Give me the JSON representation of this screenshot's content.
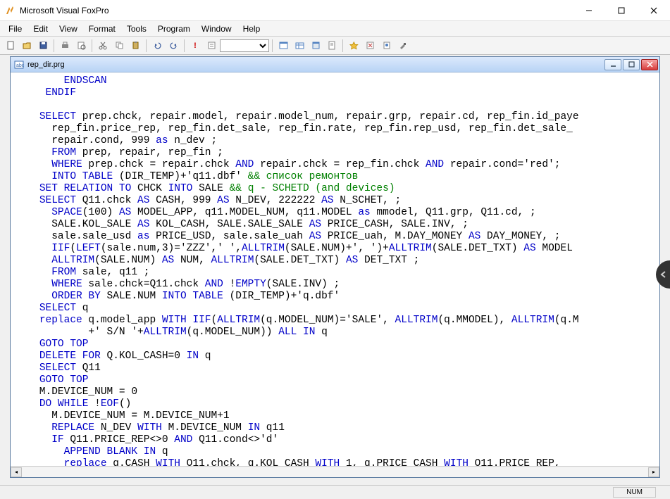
{
  "app": {
    "title": "Microsoft Visual FoxPro"
  },
  "menu": {
    "file": "File",
    "edit": "Edit",
    "view": "View",
    "format": "Format",
    "tools": "Tools",
    "program": "Program",
    "window": "Window",
    "help": "Help"
  },
  "toolbar": {
    "combo_value": ""
  },
  "doc": {
    "filename": "rep_dir.prg"
  },
  "code_lines": [
    {
      "indent": 8,
      "segs": [
        {
          "t": "ENDSCAN",
          "c": "kw"
        }
      ]
    },
    {
      "indent": 5,
      "segs": [
        {
          "t": "ENDIF",
          "c": "kw"
        }
      ]
    },
    {
      "indent": 0,
      "segs": [
        {
          "t": "",
          "c": ""
        }
      ]
    },
    {
      "indent": 4,
      "segs": [
        {
          "t": "SELECT",
          "c": "kw"
        },
        {
          "t": " prep.chck, repair.model, repair.model_num, repair.grp, repair.cd, rep_fin.id_paye",
          "c": ""
        }
      ]
    },
    {
      "indent": 6,
      "segs": [
        {
          "t": "rep_fin.price_rep, rep_fin.det_sale, rep_fin.rate, rep_fin.rep_usd, rep_fin.det_sale_",
          "c": ""
        }
      ]
    },
    {
      "indent": 6,
      "segs": [
        {
          "t": "repair.cond, 999 ",
          "c": ""
        },
        {
          "t": "as",
          "c": "kw"
        },
        {
          "t": " n_dev ;",
          "c": ""
        }
      ]
    },
    {
      "indent": 6,
      "segs": [
        {
          "t": "FROM",
          "c": "kw"
        },
        {
          "t": " prep, repair, rep_fin ;",
          "c": ""
        }
      ]
    },
    {
      "indent": 6,
      "segs": [
        {
          "t": "WHERE",
          "c": "kw"
        },
        {
          "t": " prep.chck = repair.chck ",
          "c": ""
        },
        {
          "t": "AND",
          "c": "kw"
        },
        {
          "t": " repair.chck = rep_fin.chck ",
          "c": ""
        },
        {
          "t": "AND",
          "c": "kw"
        },
        {
          "t": " repair.cond='red';",
          "c": ""
        }
      ]
    },
    {
      "indent": 6,
      "segs": [
        {
          "t": "INTO TABLE",
          "c": "kw"
        },
        {
          "t": " (DIR_TEMP)+'q11.dbf' ",
          "c": ""
        },
        {
          "t": "&& список ремонтов",
          "c": "cm"
        }
      ]
    },
    {
      "indent": 4,
      "segs": [
        {
          "t": "SET RELATION TO",
          "c": "kw"
        },
        {
          "t": " CHCK ",
          "c": ""
        },
        {
          "t": "INTO",
          "c": "kw"
        },
        {
          "t": " SALE ",
          "c": ""
        },
        {
          "t": "&& q - SCHETD (and devices)",
          "c": "cm"
        }
      ]
    },
    {
      "indent": 4,
      "segs": [
        {
          "t": "SELECT",
          "c": "kw"
        },
        {
          "t": " Q11.chck ",
          "c": ""
        },
        {
          "t": "AS",
          "c": "kw"
        },
        {
          "t": " CASH, 999 ",
          "c": ""
        },
        {
          "t": "AS",
          "c": "kw"
        },
        {
          "t": " N_DEV, 222222 ",
          "c": ""
        },
        {
          "t": "AS",
          "c": "kw"
        },
        {
          "t": " N_SCHET, ;",
          "c": ""
        }
      ]
    },
    {
      "indent": 6,
      "segs": [
        {
          "t": "SPACE",
          "c": "kw"
        },
        {
          "t": "(100) ",
          "c": ""
        },
        {
          "t": "AS",
          "c": "kw"
        },
        {
          "t": " MODEL_APP, q11.MODEL_NUM, q11.MODEL ",
          "c": ""
        },
        {
          "t": "as",
          "c": "kw"
        },
        {
          "t": " mmodel, Q11.grp, Q11.cd, ;",
          "c": ""
        }
      ]
    },
    {
      "indent": 6,
      "segs": [
        {
          "t": "SALE.KOL_SALE ",
          "c": ""
        },
        {
          "t": "AS",
          "c": "kw"
        },
        {
          "t": " KOL_CASH, SALE.SALE_SALE ",
          "c": ""
        },
        {
          "t": "AS",
          "c": "kw"
        },
        {
          "t": " PRICE_CASH, SALE.INV, ;",
          "c": ""
        }
      ]
    },
    {
      "indent": 6,
      "segs": [
        {
          "t": "sale.sale_usd ",
          "c": ""
        },
        {
          "t": "as",
          "c": "kw"
        },
        {
          "t": " PRICE_USD, sale.sale_uah ",
          "c": ""
        },
        {
          "t": "AS",
          "c": "kw"
        },
        {
          "t": " PRICE_uah, M.DAY_MONEY ",
          "c": ""
        },
        {
          "t": "AS",
          "c": "kw"
        },
        {
          "t": " DAY_MONEY, ;",
          "c": ""
        }
      ]
    },
    {
      "indent": 6,
      "segs": [
        {
          "t": "IIF",
          "c": "kw"
        },
        {
          "t": "(",
          "c": ""
        },
        {
          "t": "LEFT",
          "c": "kw"
        },
        {
          "t": "(sale.num,3)='ZZZ',' ',",
          "c": ""
        },
        {
          "t": "ALLTRIM",
          "c": "kw"
        },
        {
          "t": "(SALE.NUM)+', ')+",
          "c": ""
        },
        {
          "t": "ALLTRIM",
          "c": "kw"
        },
        {
          "t": "(SALE.DET_TXT) ",
          "c": ""
        },
        {
          "t": "AS",
          "c": "kw"
        },
        {
          "t": " MODEL",
          "c": ""
        }
      ]
    },
    {
      "indent": 6,
      "segs": [
        {
          "t": "ALLTRIM",
          "c": "kw"
        },
        {
          "t": "(SALE.NUM) ",
          "c": ""
        },
        {
          "t": "AS",
          "c": "kw"
        },
        {
          "t": " NUM, ",
          "c": ""
        },
        {
          "t": "ALLTRIM",
          "c": "kw"
        },
        {
          "t": "(SALE.DET_TXT) ",
          "c": ""
        },
        {
          "t": "AS",
          "c": "kw"
        },
        {
          "t": " DET_TXT ;",
          "c": ""
        }
      ]
    },
    {
      "indent": 6,
      "segs": [
        {
          "t": "FROM",
          "c": "kw"
        },
        {
          "t": " sale, q11 ;",
          "c": ""
        }
      ]
    },
    {
      "indent": 6,
      "segs": [
        {
          "t": "WHERE",
          "c": "kw"
        },
        {
          "t": " sale.chck=Q11.chck ",
          "c": ""
        },
        {
          "t": "AND",
          "c": "kw"
        },
        {
          "t": " !",
          "c": ""
        },
        {
          "t": "EMPTY",
          "c": "kw"
        },
        {
          "t": "(SALE.INV) ;",
          "c": ""
        }
      ]
    },
    {
      "indent": 6,
      "segs": [
        {
          "t": "ORDER BY",
          "c": "kw"
        },
        {
          "t": " SALE.NUM ",
          "c": ""
        },
        {
          "t": "INTO TABLE",
          "c": "kw"
        },
        {
          "t": " (DIR_TEMP)+'q.dbf'",
          "c": ""
        }
      ]
    },
    {
      "indent": 4,
      "segs": [
        {
          "t": "SELECT",
          "c": "kw"
        },
        {
          "t": " q",
          "c": ""
        }
      ]
    },
    {
      "indent": 4,
      "segs": [
        {
          "t": "replace",
          "c": "kw"
        },
        {
          "t": " q.model_app ",
          "c": ""
        },
        {
          "t": "WITH IIF",
          "c": "kw"
        },
        {
          "t": "(",
          "c": ""
        },
        {
          "t": "ALLTRIM",
          "c": "kw"
        },
        {
          "t": "(q.MODEL_NUM)='SALE', ",
          "c": ""
        },
        {
          "t": "ALLTRIM",
          "c": "kw"
        },
        {
          "t": "(q.MMODEL), ",
          "c": ""
        },
        {
          "t": "ALLTRIM",
          "c": "kw"
        },
        {
          "t": "(q.M",
          "c": ""
        }
      ]
    },
    {
      "indent": 12,
      "segs": [
        {
          "t": "+' S/N '+",
          "c": ""
        },
        {
          "t": "ALLTRIM",
          "c": "kw"
        },
        {
          "t": "(q.MODEL_NUM)) ",
          "c": ""
        },
        {
          "t": "ALL IN",
          "c": "kw"
        },
        {
          "t": " q",
          "c": ""
        }
      ]
    },
    {
      "indent": 4,
      "segs": [
        {
          "t": "GOTO TOP",
          "c": "kw"
        }
      ]
    },
    {
      "indent": 4,
      "segs": [
        {
          "t": "DELETE FOR",
          "c": "kw"
        },
        {
          "t": " Q.KOL_CASH=0 ",
          "c": ""
        },
        {
          "t": "IN",
          "c": "kw"
        },
        {
          "t": " q",
          "c": ""
        }
      ]
    },
    {
      "indent": 4,
      "segs": [
        {
          "t": "SELECT",
          "c": "kw"
        },
        {
          "t": " Q11",
          "c": ""
        }
      ]
    },
    {
      "indent": 4,
      "segs": [
        {
          "t": "GOTO TOP",
          "c": "kw"
        }
      ]
    },
    {
      "indent": 4,
      "segs": [
        {
          "t": "M.DEVICE_NUM = 0",
          "c": ""
        }
      ]
    },
    {
      "indent": 4,
      "segs": [
        {
          "t": "DO WHILE",
          "c": "kw"
        },
        {
          "t": " !",
          "c": ""
        },
        {
          "t": "EOF",
          "c": "kw"
        },
        {
          "t": "()",
          "c": ""
        }
      ]
    },
    {
      "indent": 6,
      "segs": [
        {
          "t": "M.DEVICE_NUM = M.DEVICE_NUM+1",
          "c": ""
        }
      ]
    },
    {
      "indent": 6,
      "segs": [
        {
          "t": "REPLACE",
          "c": "kw"
        },
        {
          "t": " N_DEV ",
          "c": ""
        },
        {
          "t": "WITH",
          "c": "kw"
        },
        {
          "t": " M.DEVICE_NUM ",
          "c": ""
        },
        {
          "t": "IN",
          "c": "kw"
        },
        {
          "t": " q11",
          "c": ""
        }
      ]
    },
    {
      "indent": 6,
      "segs": [
        {
          "t": "IF",
          "c": "kw"
        },
        {
          "t": " Q11.PRICE_REP<>0 ",
          "c": ""
        },
        {
          "t": "AND",
          "c": "kw"
        },
        {
          "t": " Q11.cond<>'d'",
          "c": ""
        }
      ]
    },
    {
      "indent": 8,
      "segs": [
        {
          "t": "APPEND BLANK IN",
          "c": "kw"
        },
        {
          "t": " q",
          "c": ""
        }
      ]
    },
    {
      "indent": 8,
      "segs": [
        {
          "t": "replace",
          "c": "kw"
        },
        {
          "t": " q.CASH ",
          "c": ""
        },
        {
          "t": "WITH",
          "c": "kw"
        },
        {
          "t": " Q11.chck, q.KOL_CASH ",
          "c": ""
        },
        {
          "t": "WITH",
          "c": "kw"
        },
        {
          "t": " 1, q.PRICE_CASH ",
          "c": ""
        },
        {
          "t": "WITH",
          "c": "kw"
        },
        {
          "t": " Q11.PRICE_REP,  ",
          "c": ""
        }
      ]
    }
  ],
  "status": {
    "num": "NUM"
  }
}
